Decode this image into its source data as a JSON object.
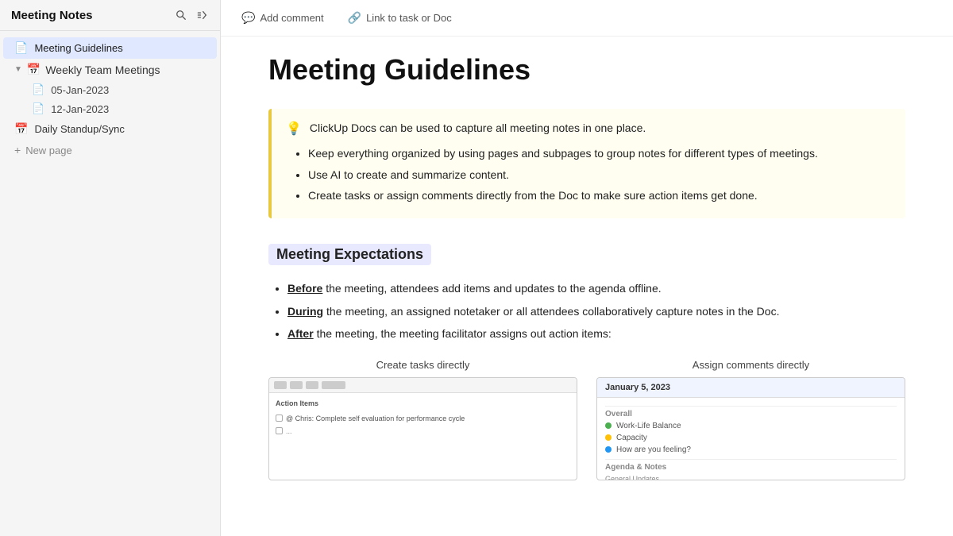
{
  "sidebar": {
    "title": "Meeting Notes",
    "items": [
      {
        "id": "meeting-guidelines",
        "label": "Meeting Guidelines",
        "icon": "📄",
        "type": "page",
        "active": true
      },
      {
        "id": "weekly-team-meetings",
        "label": "Weekly Team Meetings",
        "icon": "📅",
        "type": "group",
        "expanded": true,
        "children": [
          {
            "id": "05-jan-2023",
            "label": "05-Jan-2023",
            "icon": "📄"
          },
          {
            "id": "12-jan-2023",
            "label": "12-Jan-2023",
            "icon": "📄"
          }
        ]
      },
      {
        "id": "daily-standup",
        "label": "Daily Standup/Sync",
        "icon": "📅",
        "type": "page"
      }
    ],
    "add_label": "New page"
  },
  "toolbar": {
    "comment_label": "Add comment",
    "link_label": "Link to task or Doc"
  },
  "main": {
    "title": "Meeting Guidelines",
    "callout": {
      "icon": "💡",
      "text": "ClickUp Docs can be used to capture all meeting notes in one place.",
      "bullets": [
        "Keep everything organized by using pages and subpages to group notes for different types of meetings.",
        "Use AI to create and summarize content.",
        "Create tasks or assign comments directly from the Doc to make sure action items get done."
      ]
    },
    "section1": {
      "heading": "Meeting Expectations",
      "bullets": [
        {
          "prefix": "Before",
          "text": " the meeting, attendees add items and updates to the agenda offline."
        },
        {
          "prefix": "During",
          "text": " the meeting, an assigned notetaker or all attendees collaboratively capture notes in the Doc."
        },
        {
          "prefix": "After",
          "text": " the meeting, the meeting facilitator assigns out action items:"
        }
      ]
    },
    "images": [
      {
        "caption": "Create tasks directly"
      },
      {
        "caption": "Assign comments directly",
        "date": "January 5, 2023"
      }
    ]
  }
}
